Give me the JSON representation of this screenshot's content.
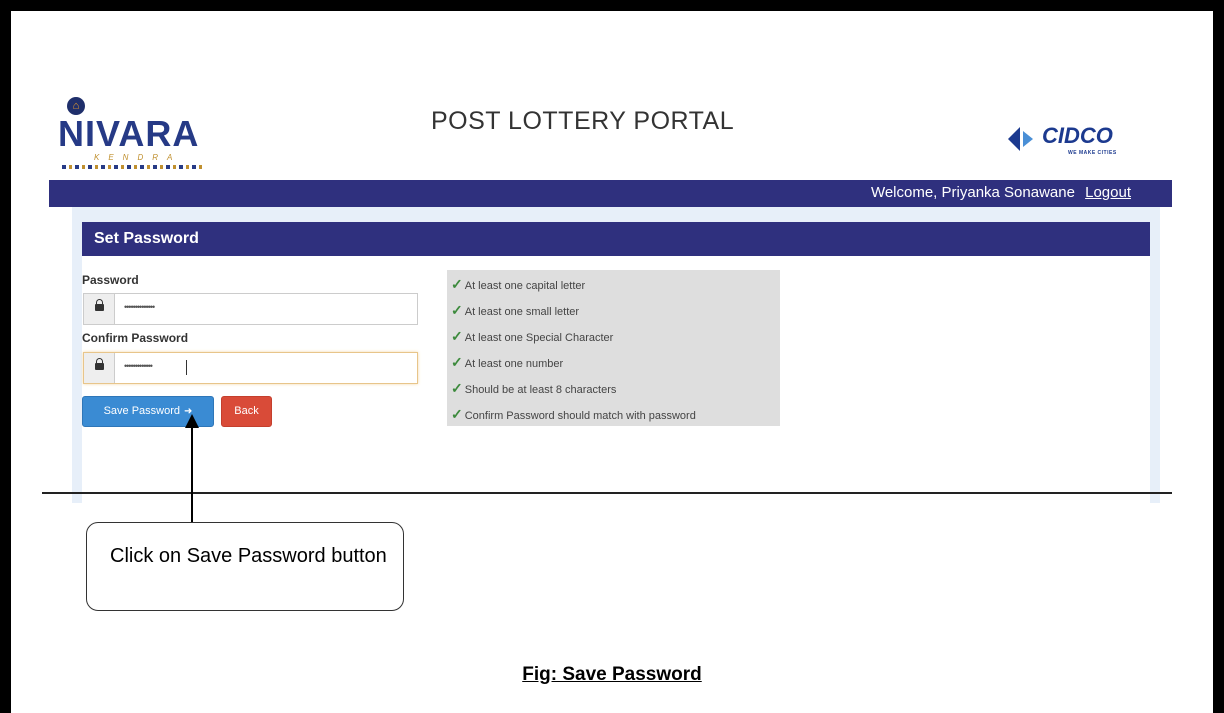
{
  "header": {
    "nivara_logo": "NIVARA",
    "nivara_sub": "KENDRA",
    "portal_title": "POST LOTTERY PORTAL",
    "cidco_logo": "CIDCO",
    "cidco_tagline": "WE MAKE CITIES"
  },
  "navbar": {
    "welcome": "Welcome,  Priyanka Sonawane",
    "logout": "Logout"
  },
  "form": {
    "title": "Set Password",
    "password_label": "Password",
    "password_value": "••••••••••••••",
    "confirm_label": "Confirm Password",
    "confirm_value": "•••••••••••••",
    "save_button": "Save Password",
    "back_button": "Back"
  },
  "rules": [
    "At least one capital letter",
    "At least one small letter",
    "At least one Special Character",
    "At least one number",
    "Should be at least 8 characters",
    "Confirm Password should match with password"
  ],
  "annotation": {
    "callout": "Click on Save Password button",
    "caption": "Fig: Save Password"
  },
  "colors": {
    "navbar": "#2f307e",
    "save_button": "#3a8bd3",
    "back_button": "#d94b38",
    "check": "#3c8a3c"
  },
  "icons": {
    "lock": "lock-icon",
    "sign_in": "sign-in-icon",
    "check": "check-icon"
  }
}
